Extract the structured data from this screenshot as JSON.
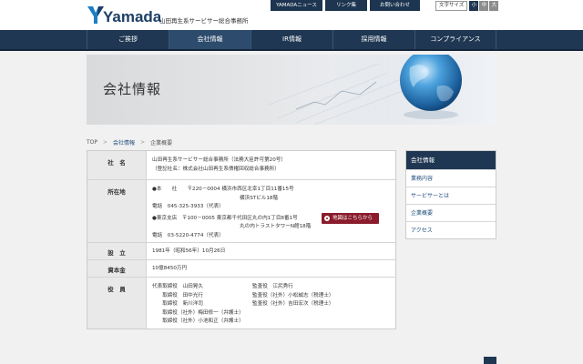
{
  "header": {
    "logo_word": "Yamada",
    "logo_sub": "山田再生系サービサー総合事務所",
    "util_links": [
      "YAMADAニュース",
      "リンク集",
      "お問い合わせ"
    ],
    "font_size_label": "文字サイズ",
    "font_size_options": [
      "小",
      "中",
      "大"
    ]
  },
  "gnav": {
    "items": [
      "ご挨拶",
      "会社情報",
      "IR情報",
      "採用情報",
      "コンプライアンス"
    ],
    "active": "会社情報"
  },
  "hero": {
    "title": "会社情報"
  },
  "breadcrumb": {
    "top": "TOP",
    "parent": "会社情報",
    "current": "企業概要"
  },
  "company": {
    "name_label": "社　名",
    "name_line1": "山田再生系サービサー総合事務所（法務大臣許可第20号）",
    "name_line2": "（登記社名：株式会社山田再生系債権回収総合事務所）",
    "location_label": "所在地",
    "hq_line1": "●本　　社　　〒220－0004 横浜市西区北幸1丁目11番15号",
    "hq_line2": "横浜STビル18階",
    "hq_tel": "電話　045-325-3933（代表）",
    "map_button": "地図はこちらから",
    "tokyo_line1": "●東京支店　〒100－0005 東京都千代田区丸の内1丁目8番1号",
    "tokyo_line2": "丸の内トラストタワーN館18階",
    "tokyo_tel": "電話　03-5220-4774（代表）",
    "founded_label": "設　立",
    "founded_value": "1981年（昭和56年）10月26日",
    "capital_label": "資本金",
    "capital_value": "10億8450万円",
    "officers_label": "役　員",
    "officers": [
      "代表取締役　山田晃久",
      "監査役　江尻秀行",
      "　　取締役　田中光行",
      "監査役（社外）小松誠志（税理士）",
      "　　取締役　新川洋司",
      "監査役（社外）吉田宏次（税理士）",
      "　　取締役（社外）梅田修一（弁護士）",
      "",
      "　　取締役（社外）小池和正（弁護士）",
      ""
    ]
  },
  "sidebar": {
    "heading": "会社情報",
    "items": [
      "業務内容",
      "サービサーとは",
      "企業概要",
      "アクセス"
    ]
  },
  "colors": {
    "navy": "#1f3752",
    "map_button": "#8a1c2b"
  }
}
